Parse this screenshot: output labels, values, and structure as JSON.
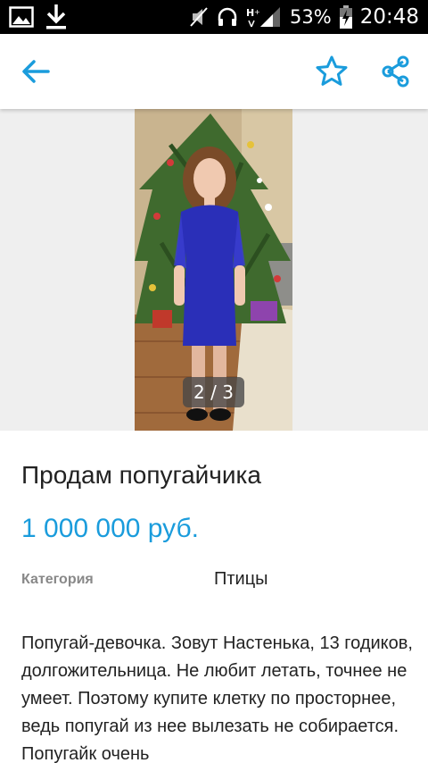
{
  "status_bar": {
    "battery": "53%",
    "time": "20:48",
    "icons": [
      "image-notification-icon",
      "download-icon",
      "mute-icon",
      "headphones-icon",
      "network-signal-icon",
      "battery-charging-icon"
    ]
  },
  "app_bar": {
    "back_icon": "arrow-left-icon",
    "favorite_icon": "star-outline-icon",
    "share_icon": "share-icon",
    "accent_color": "#1a9cdc"
  },
  "gallery": {
    "counter": "2 / 3"
  },
  "listing": {
    "title": "Продам попугайчика",
    "price": "1 000 000 руб.",
    "category_label": "Категория",
    "category_value": "Птицы",
    "description": "Попугай-девочка. Зовут Настенька, 13 годиков, долгожительница. Не любит летать, точнее не умеет. Поэтому купите клетку по просторнее, ведь попугай из нее вылезать не собирается. Попугайк очень"
  }
}
